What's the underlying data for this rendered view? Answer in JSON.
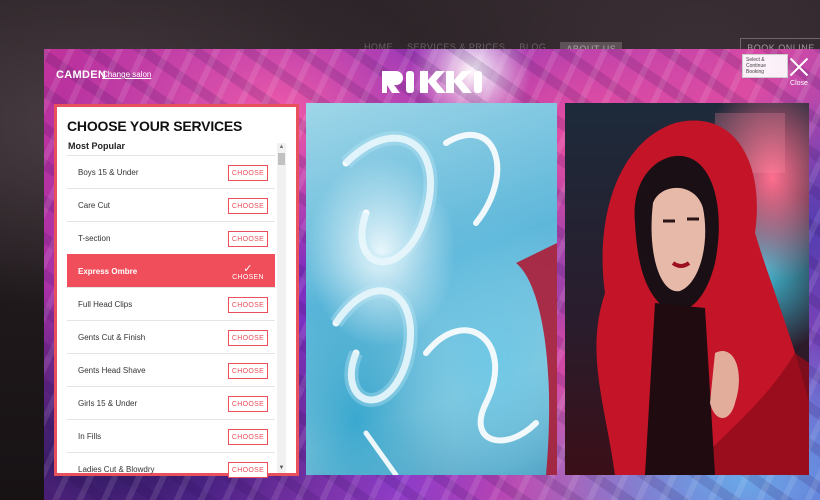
{
  "nav": {
    "items": [
      "Home",
      "Services & Prices",
      "Blog",
      "About Us"
    ],
    "book_label": "BOOK ONLINE"
  },
  "header": {
    "salon": "CAMDEN",
    "change_salon": "Change salon",
    "logo": "RIKKI",
    "close_label": "Close",
    "tooltip": "Select & Continue Booking"
  },
  "services": {
    "title": "CHOOSE YOUR SERVICES",
    "category": "Most Popular",
    "choose_label": "CHOOSE",
    "chosen_label": "CHOSEN",
    "items": [
      {
        "name": "Boys 15 & Under",
        "state": "CHOOSE"
      },
      {
        "name": "Care Cut",
        "state": "CHOOSE"
      },
      {
        "name": "T-section",
        "state": "CHOOSE"
      },
      {
        "name": "Express Ombre",
        "state": "CHOSEN"
      },
      {
        "name": "Full Head Clips",
        "state": "CHOOSE"
      },
      {
        "name": "Gents Cut & Finish",
        "state": "CHOOSE"
      },
      {
        "name": "Gents Head Shave",
        "state": "CHOOSE"
      },
      {
        "name": "Girls 15 & Under",
        "state": "CHOOSE"
      },
      {
        "name": "In Fills",
        "state": "CHOOSE"
      },
      {
        "name": "Ladies Cut & Blowdry",
        "state": "CHOOSE"
      }
    ]
  },
  "colors": {
    "accent": "#e8505b",
    "chosen_bg": "#ef4e5a"
  }
}
